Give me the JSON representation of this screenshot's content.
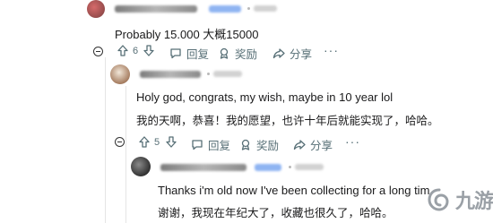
{
  "comment1": {
    "body": "Probably 15.000 大概15000",
    "votes": "6",
    "reply_label": "回复",
    "award_label": "奖励",
    "share_label": "分享",
    "more": "···"
  },
  "comment2": {
    "body_en": "Holy god, congrats, my wish, maybe in 10 year lol",
    "body_zh": "我的天啊，恭喜！我的愿望，也许十年后就能实现了，哈哈。",
    "votes": "5",
    "reply_label": "回复",
    "award_label": "奖励",
    "share_label": "分享",
    "more": "···"
  },
  "comment3": {
    "body_en": "Thanks i'm old now I've been collecting for a long tim",
    "body_zh": "谢谢，我现在年纪大了，收藏也很久了，哈哈。"
  },
  "watermark": {
    "text": "九游",
    "color": "#9aa0a6"
  },
  "colors": {
    "accent": "#4a7fe0",
    "action_text": "#576f76"
  }
}
